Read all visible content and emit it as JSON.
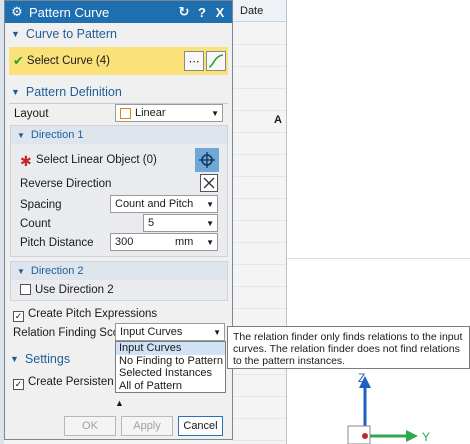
{
  "background": {
    "column_header": "Date",
    "marker": "A",
    "axis_z": "Z",
    "axis_y": "Y"
  },
  "dialog": {
    "title": "Pattern Curve",
    "title_buttons": [
      "↻",
      "?",
      "X"
    ],
    "curve_to_pattern": {
      "header": "Curve to Pattern",
      "select_label": "Select Curve (4)"
    },
    "pattern_definition": {
      "header": "Pattern Definition",
      "layout_label": "Layout",
      "layout_value": "Linear",
      "direction1": {
        "header": "Direction 1",
        "select_linear": "Select Linear Object (0)",
        "reverse_direction": "Reverse Direction",
        "spacing_label": "Spacing",
        "spacing_value": "Count and Pitch",
        "count_label": "Count",
        "count_value": "5",
        "pitch_label": "Pitch Distance",
        "pitch_value": "300",
        "pitch_unit": "mm"
      },
      "direction2": {
        "header": "Direction 2",
        "use_direction2": "Use Direction 2",
        "use_direction2_checked": false
      },
      "create_pitch_expressions": "Create Pitch Expressions",
      "create_pitch_checked": true,
      "relation_scope_label": "Relation Finding Scope",
      "relation_scope_value": "Input Curves",
      "relation_scope_options": [
        "Input Curves",
        "No Finding to Pattern",
        "Selected Instances",
        "All of Pattern"
      ]
    },
    "settings": {
      "header": "Settings",
      "create_persistent": "Create Persistent Rela",
      "create_persistent_checked": true
    },
    "buttons": {
      "ok": "OK",
      "apply": "Apply",
      "cancel": "Cancel"
    }
  },
  "tooltip": "The relation finder only finds relations to the input curves. The relation finder does not find relations to the pattern instances.",
  "colors": {
    "title_bar": "#1d6fb0",
    "selection_highlight": "#fbe17a",
    "group_header_text": "#1f5d9a",
    "axis_z": "#1f5fc0",
    "axis_y": "#2fa84f"
  }
}
